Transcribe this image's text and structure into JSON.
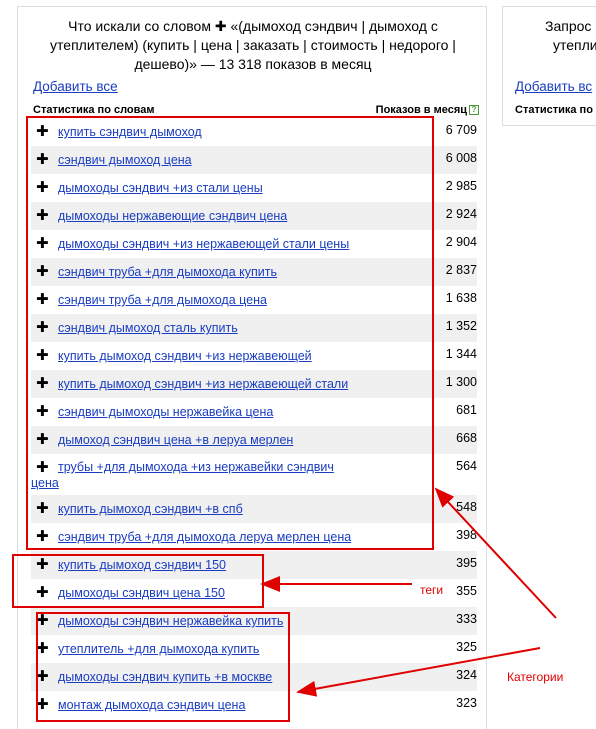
{
  "main": {
    "title_prefix": "Что искали со словом",
    "title_plus": "✚",
    "title_rest": "«(дымоход сэндвич | дымоход с утеплителем) (купить | цена | заказать | стоимость | недорого | дешево)» — 13 318 показов в месяц",
    "add_all": "Добавить все",
    "col_words": "Статистика по словам",
    "col_shows": "Показов в месяц",
    "help": "?"
  },
  "side": {
    "title_line1": "Запрос",
    "title_line2": "утепли",
    "add_all": "Добавить вс",
    "col_words": "Статистика по с"
  },
  "rows": [
    {
      "q": "купить сэндвич дымоход",
      "n": "6 709"
    },
    {
      "q": "сэндвич дымоход цена",
      "n": "6 008"
    },
    {
      "q": "дымоходы сэндвич +из стали цены",
      "n": "2 985"
    },
    {
      "q": "дымоходы нержавеющие сэндвич цена",
      "n": "2 924"
    },
    {
      "q": "дымоходы сэндвич +из нержавеющей стали цены",
      "n": "2 904"
    },
    {
      "q": "сэндвич труба +для дымохода купить",
      "n": "2 837"
    },
    {
      "q": "сэндвич труба +для дымохода цена",
      "n": "1 638"
    },
    {
      "q": "сэндвич дымоход сталь купить",
      "n": "1 352"
    },
    {
      "q": "купить дымоход сэндвич +из нержавеющей",
      "n": "1 344"
    },
    {
      "q": "купить дымоход сэндвич +из нержавеющей стали",
      "n": "1 300"
    },
    {
      "q": "сэндвич дымоходы нержавейка цена",
      "n": "681"
    },
    {
      "q": "дымоход сэндвич цена +в леруа мерлен",
      "n": "668"
    },
    {
      "q": "трубы +для дымохода +из нержавейки сэндвич цена",
      "n": "564"
    },
    {
      "q": "купить дымоход сэндвич +в спб",
      "n": "548"
    },
    {
      "q": "сэндвич труба +для дымохода леруа мерлен цена",
      "n": "398"
    },
    {
      "q": "купить дымоход сэндвич 150",
      "n": "395"
    },
    {
      "q": "дымоходы сэндвич цена 150",
      "n": "355"
    },
    {
      "q": "дымоходы сэндвич нержавейка купить",
      "n": "333"
    },
    {
      "q": "утеплитель +для дымохода купить",
      "n": "325"
    },
    {
      "q": "дымоходы сэндвич купить +в москве",
      "n": "324"
    },
    {
      "q": "монтаж дымохода сэндвич цена",
      "n": "323"
    }
  ],
  "annotations": {
    "tags": "теги",
    "categories": "Категории",
    "color": "#e00000"
  },
  "colors": {
    "link": "#1a3dc1",
    "stripe": "#f0f0f0"
  }
}
